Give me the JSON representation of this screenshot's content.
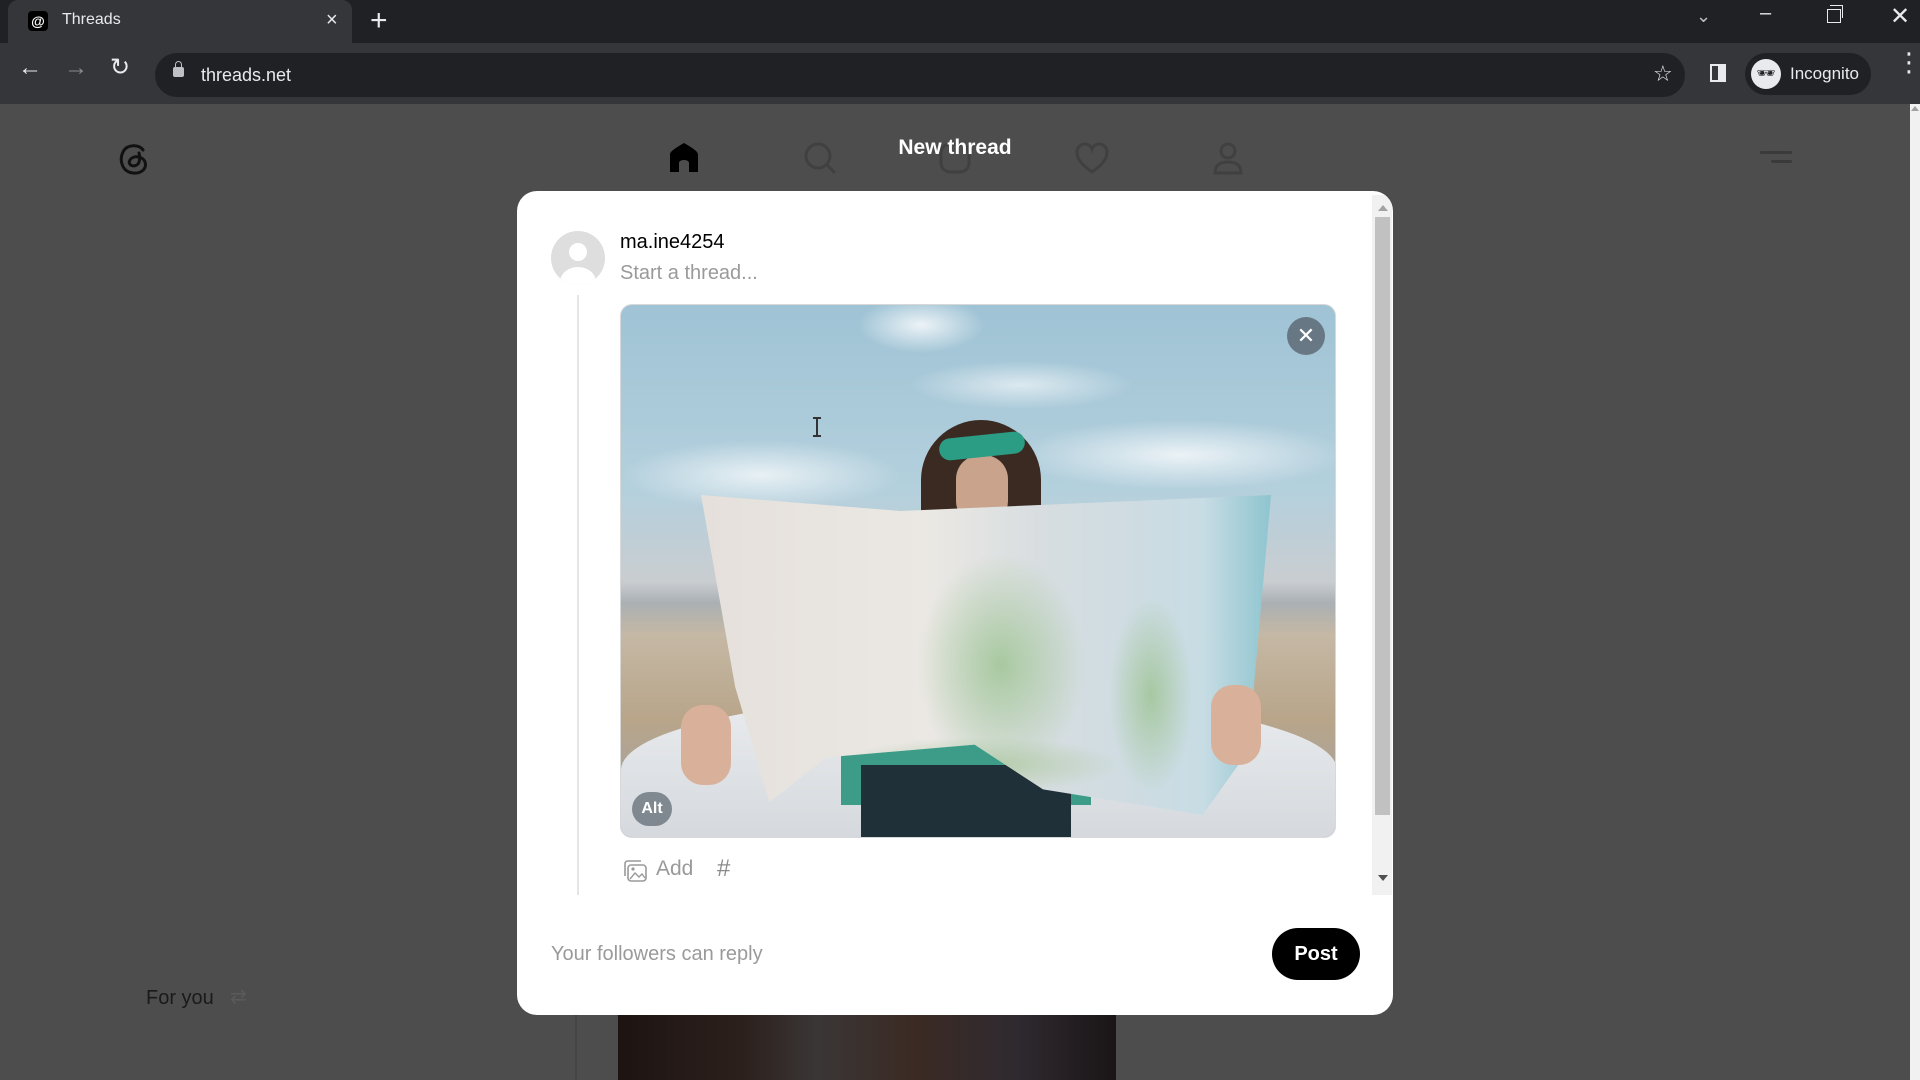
{
  "browser": {
    "tab": {
      "title": "Threads",
      "favicon": "threads-logo",
      "close": "×"
    },
    "new_tab": "+",
    "tab_search": "⌄",
    "window_controls": {
      "minimize": "–",
      "close": "✕"
    },
    "nav": {
      "back": "←",
      "forward": "→",
      "reload": "↻"
    },
    "url": "threads.net",
    "bookmark_icon": "☆",
    "profile_label": "Incognito",
    "incognito_icon": "🕶",
    "menu_icon": "⋮"
  },
  "app": {
    "logo": "@",
    "nav_items": [
      "home",
      "search",
      "new-thread",
      "activity",
      "profile"
    ],
    "active_nav": "home",
    "feed_tab": {
      "label": "For you",
      "icon": "⇄"
    }
  },
  "modal": {
    "title": "New thread",
    "username": "ma.ine4254",
    "thread_placeholder": "Start a thread...",
    "thread_value": "",
    "attachment": {
      "description": "Woman in green headband holding a large open road map, sky and mountains behind",
      "remove_icon": "✕",
      "alt_label": "Alt"
    },
    "add_label": "Add",
    "hashtag_icon": "#",
    "reply_setting": "Your followers can reply",
    "post_label": "Post"
  }
}
